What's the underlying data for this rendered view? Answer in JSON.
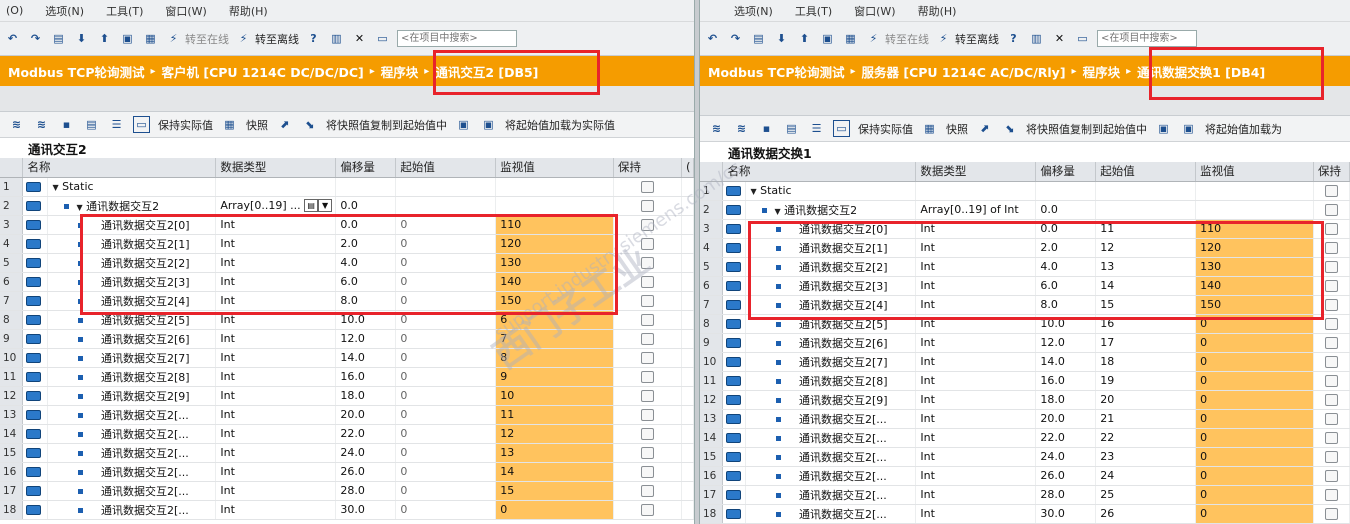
{
  "left": {
    "menu": [
      "(O)",
      "选项(N)",
      "工具(T)",
      "窗口(W)",
      "帮助(H)"
    ],
    "toolbar": {
      "online": "转至在线",
      "offline": "转至离线",
      "search_placeholder": "<在项目中搜索>"
    },
    "breadcrumb": [
      "Modbus TCP轮询测试",
      "客户机 [CPU 1214C DC/DC/DC]",
      "程序块",
      "通讯交互2 [DB5]"
    ],
    "toolbar2": {
      "keep": "保持实际值",
      "snapshot": "快照",
      "copy": "将快照值复制到起始值中",
      "load": "将起始值加载为实际值"
    },
    "block_title": "通讯交互2",
    "columns": [
      "名称",
      "数据类型",
      "偏移量",
      "起始值",
      "监视值",
      "保持",
      "("
    ],
    "rows": [
      {
        "n": "1",
        "name": "Static",
        "type": "",
        "off": "",
        "start": "",
        "mon": "",
        "lvl": 0
      },
      {
        "n": "2",
        "name": "通讯数据交互2",
        "type": "Array[0..19] ...",
        "off": "0.0",
        "start": "",
        "mon": "",
        "lvl": 1
      },
      {
        "n": "3",
        "name": "通讯数据交互2[0]",
        "type": "Int",
        "off": "0.0",
        "start": "0",
        "mon": "110",
        "lvl": 2
      },
      {
        "n": "4",
        "name": "通讯数据交互2[1]",
        "type": "Int",
        "off": "2.0",
        "start": "0",
        "mon": "120",
        "lvl": 2
      },
      {
        "n": "5",
        "name": "通讯数据交互2[2]",
        "type": "Int",
        "off": "4.0",
        "start": "0",
        "mon": "130",
        "lvl": 2
      },
      {
        "n": "6",
        "name": "通讯数据交互2[3]",
        "type": "Int",
        "off": "6.0",
        "start": "0",
        "mon": "140",
        "lvl": 2
      },
      {
        "n": "7",
        "name": "通讯数据交互2[4]",
        "type": "Int",
        "off": "8.0",
        "start": "0",
        "mon": "150",
        "lvl": 2
      },
      {
        "n": "8",
        "name": "通讯数据交互2[5]",
        "type": "Int",
        "off": "10.0",
        "start": "0",
        "mon": "6",
        "lvl": 2
      },
      {
        "n": "9",
        "name": "通讯数据交互2[6]",
        "type": "Int",
        "off": "12.0",
        "start": "0",
        "mon": "7",
        "lvl": 2
      },
      {
        "n": "10",
        "name": "通讯数据交互2[7]",
        "type": "Int",
        "off": "14.0",
        "start": "0",
        "mon": "8",
        "lvl": 2
      },
      {
        "n": "11",
        "name": "通讯数据交互2[8]",
        "type": "Int",
        "off": "16.0",
        "start": "0",
        "mon": "9",
        "lvl": 2
      },
      {
        "n": "12",
        "name": "通讯数据交互2[9]",
        "type": "Int",
        "off": "18.0",
        "start": "0",
        "mon": "10",
        "lvl": 2
      },
      {
        "n": "13",
        "name": "通讯数据交互2[...",
        "type": "Int",
        "off": "20.0",
        "start": "0",
        "mon": "11",
        "lvl": 2
      },
      {
        "n": "14",
        "name": "通讯数据交互2[...",
        "type": "Int",
        "off": "22.0",
        "start": "0",
        "mon": "12",
        "lvl": 2
      },
      {
        "n": "15",
        "name": "通讯数据交互2[...",
        "type": "Int",
        "off": "24.0",
        "start": "0",
        "mon": "13",
        "lvl": 2
      },
      {
        "n": "16",
        "name": "通讯数据交互2[...",
        "type": "Int",
        "off": "26.0",
        "start": "0",
        "mon": "14",
        "lvl": 2
      },
      {
        "n": "17",
        "name": "通讯数据交互2[...",
        "type": "Int",
        "off": "28.0",
        "start": "0",
        "mon": "15",
        "lvl": 2
      },
      {
        "n": "18",
        "name": "通讯数据交互2[...",
        "type": "Int",
        "off": "30.0",
        "start": "0",
        "mon": "0",
        "lvl": 2
      }
    ]
  },
  "right": {
    "menu": [
      "选项(N)",
      "工具(T)",
      "窗口(W)",
      "帮助(H)"
    ],
    "toolbar": {
      "online": "转至在线",
      "offline": "转至离线",
      "search_placeholder": "<在项目中搜索>"
    },
    "breadcrumb": [
      "Modbus TCP轮询测试",
      "服务器 [CPU 1214C AC/DC/Rly]",
      "程序块",
      "通讯数据交换1 [DB4]"
    ],
    "toolbar2": {
      "keep": "保持实际值",
      "snapshot": "快照",
      "copy": "将快照值复制到起始值中",
      "load": "将起始值加载为"
    },
    "block_title": "通讯数据交换1",
    "columns": [
      "名称",
      "数据类型",
      "偏移量",
      "起始值",
      "监视值",
      "保持"
    ],
    "rows": [
      {
        "n": "1",
        "name": "Static",
        "type": "",
        "off": "",
        "start": "",
        "mon": "",
        "lvl": 0
      },
      {
        "n": "2",
        "name": "通讯数据交互2",
        "type": "Array[0..19] of Int",
        "off": "0.0",
        "start": "",
        "mon": "",
        "lvl": 1
      },
      {
        "n": "3",
        "name": "通讯数据交互2[0]",
        "type": "Int",
        "off": "0.0",
        "start": "11",
        "mon": "110",
        "lvl": 2
      },
      {
        "n": "4",
        "name": "通讯数据交互2[1]",
        "type": "Int",
        "off": "2.0",
        "start": "12",
        "mon": "120",
        "lvl": 2
      },
      {
        "n": "5",
        "name": "通讯数据交互2[2]",
        "type": "Int",
        "off": "4.0",
        "start": "13",
        "mon": "130",
        "lvl": 2
      },
      {
        "n": "6",
        "name": "通讯数据交互2[3]",
        "type": "Int",
        "off": "6.0",
        "start": "14",
        "mon": "140",
        "lvl": 2
      },
      {
        "n": "7",
        "name": "通讯数据交互2[4]",
        "type": "Int",
        "off": "8.0",
        "start": "15",
        "mon": "150",
        "lvl": 2
      },
      {
        "n": "8",
        "name": "通讯数据交互2[5]",
        "type": "Int",
        "off": "10.0",
        "start": "16",
        "mon": "0",
        "lvl": 2
      },
      {
        "n": "9",
        "name": "通讯数据交互2[6]",
        "type": "Int",
        "off": "12.0",
        "start": "17",
        "mon": "0",
        "lvl": 2
      },
      {
        "n": "10",
        "name": "通讯数据交互2[7]",
        "type": "Int",
        "off": "14.0",
        "start": "18",
        "mon": "0",
        "lvl": 2
      },
      {
        "n": "11",
        "name": "通讯数据交互2[8]",
        "type": "Int",
        "off": "16.0",
        "start": "19",
        "mon": "0",
        "lvl": 2
      },
      {
        "n": "12",
        "name": "通讯数据交互2[9]",
        "type": "Int",
        "off": "18.0",
        "start": "20",
        "mon": "0",
        "lvl": 2
      },
      {
        "n": "13",
        "name": "通讯数据交互2[...",
        "type": "Int",
        "off": "20.0",
        "start": "21",
        "mon": "0",
        "lvl": 2
      },
      {
        "n": "14",
        "name": "通讯数据交互2[...",
        "type": "Int",
        "off": "22.0",
        "start": "22",
        "mon": "0",
        "lvl": 2
      },
      {
        "n": "15",
        "name": "通讯数据交互2[...",
        "type": "Int",
        "off": "24.0",
        "start": "23",
        "mon": "0",
        "lvl": 2
      },
      {
        "n": "16",
        "name": "通讯数据交互2[...",
        "type": "Int",
        "off": "26.0",
        "start": "24",
        "mon": "0",
        "lvl": 2
      },
      {
        "n": "17",
        "name": "通讯数据交互2[...",
        "type": "Int",
        "off": "28.0",
        "start": "25",
        "mon": "0",
        "lvl": 2
      },
      {
        "n": "18",
        "name": "通讯数据交互2[...",
        "type": "Int",
        "off": "30.0",
        "start": "26",
        "mon": "0",
        "lvl": 2
      }
    ]
  },
  "watermark": {
    "line1": "西门子工业",
    "line2": "support.industry.siemens.com/cs"
  },
  "colors": {
    "breadcrumb_bg": "#f59c00",
    "monitor_bg": "#ffc35e",
    "highlight_box": "#e8232b"
  }
}
